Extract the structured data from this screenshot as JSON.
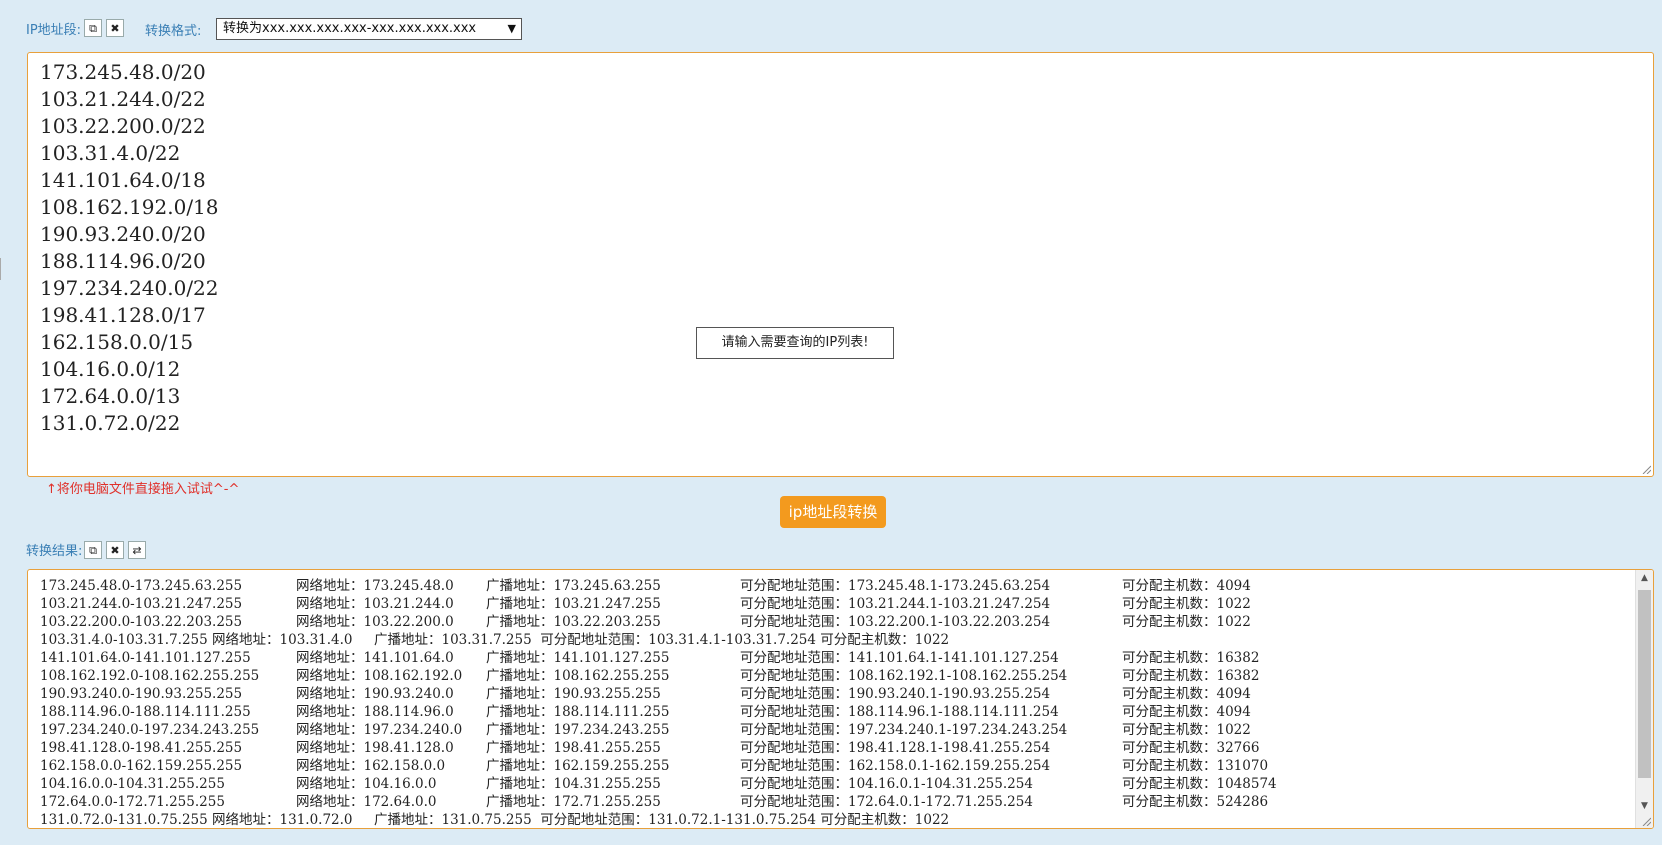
{
  "header": {
    "ip_label": "IP地址段:",
    "format_label": "转换格式:",
    "format_value": "转换为xxx.xxx.xxx.xxx-xxx.xxx.xxx.xxx"
  },
  "input": {
    "lines": [
      "173.245.48.0/20",
      "103.21.244.0/22",
      "103.22.200.0/22",
      "103.31.4.0/22",
      "141.101.64.0/18",
      "108.162.192.0/18",
      "190.93.240.0/20",
      "188.114.96.0/20",
      "197.234.240.0/22",
      "198.41.128.0/17",
      "162.158.0.0/15",
      "104.16.0.0/12",
      "172.64.0.0/13",
      "131.0.72.0/22"
    ],
    "tooltip": "请输入需要查询的IP列表!",
    "drag_hint": "↑将你电脑文件直接拖入试试^-^"
  },
  "convert_button": "ip地址段转换",
  "result": {
    "label": "转换结果:",
    "rows": [
      [
        "173.245.48.0-173.245.63.255",
        "网络地址：173.245.48.0",
        "广播地址：173.245.63.255",
        "可分配地址范围：173.245.48.1-173.245.63.254",
        "可分配主机数：4094"
      ],
      [
        "103.21.244.0-103.21.247.255",
        "网络地址：103.21.244.0",
        "广播地址：103.21.247.255",
        "可分配地址范围：103.21.244.1-103.21.247.254",
        "可分配主机数：1022"
      ],
      [
        "103.22.200.0-103.22.203.255",
        "网络地址：103.22.200.0",
        "广播地址：103.22.203.255",
        "可分配地址范围：103.22.200.1-103.22.203.254",
        "可分配主机数：1022"
      ],
      [
        "103.31.4.0-103.31.7.255 网络地址：103.31.4.0     广播地址：103.31.7.255  可分配地址范围：103.31.4.1-103.31.7.254 可分配主机数：1022"
      ],
      [
        "141.101.64.0-141.101.127.255",
        "网络地址：141.101.64.0",
        "广播地址：141.101.127.255",
        "可分配地址范围：141.101.64.1-141.101.127.254",
        "可分配主机数：16382"
      ],
      [
        "108.162.192.0-108.162.255.255",
        "网络地址：108.162.192.0",
        "广播地址：108.162.255.255",
        "可分配地址范围：108.162.192.1-108.162.255.254",
        "可分配主机数：16382"
      ],
      [
        "190.93.240.0-190.93.255.255",
        "网络地址：190.93.240.0",
        "广播地址：190.93.255.255",
        "可分配地址范围：190.93.240.1-190.93.255.254",
        "可分配主机数：4094"
      ],
      [
        "188.114.96.0-188.114.111.255",
        "网络地址：188.114.96.0",
        "广播地址：188.114.111.255",
        "可分配地址范围：188.114.96.1-188.114.111.254",
        "可分配主机数：4094"
      ],
      [
        "197.234.240.0-197.234.243.255",
        "网络地址：197.234.240.0",
        "广播地址：197.234.243.255",
        "可分配地址范围：197.234.240.1-197.234.243.254",
        "可分配主机数：1022"
      ],
      [
        "198.41.128.0-198.41.255.255",
        "网络地址：198.41.128.0",
        "广播地址：198.41.255.255",
        "可分配地址范围：198.41.128.1-198.41.255.254",
        "可分配主机数：32766"
      ],
      [
        "162.158.0.0-162.159.255.255",
        "网络地址：162.158.0.0",
        "广播地址：162.159.255.255",
        "可分配地址范围：162.158.0.1-162.159.255.254",
        "可分配主机数：131070"
      ],
      [
        "104.16.0.0-104.31.255.255",
        "网络地址：104.16.0.0",
        "广播地址：104.31.255.255",
        "可分配地址范围：104.16.0.1-104.31.255.254",
        "可分配主机数：1048574"
      ],
      [
        "172.64.0.0-172.71.255.255",
        "网络地址：172.64.0.0",
        "广播地址：172.71.255.255",
        "可分配地址范围：172.64.0.1-172.71.255.254",
        "可分配主机数：524286"
      ],
      [
        "131.0.72.0-131.0.75.255 网络地址：131.0.72.0     广播地址：131.0.75.255  可分配地址范围：131.0.72.1-131.0.75.254 可分配主机数：1022"
      ]
    ]
  },
  "icons": {
    "copy": "copy-icon",
    "clear": "close-icon",
    "swap": "swap-icon"
  },
  "colors": {
    "panel_bg": "#dcebf5",
    "accent_orange": "#f39a1e",
    "border_orange": "#e8a03c",
    "label_blue": "#3a7fb5",
    "hint_red": "#e0302a"
  }
}
